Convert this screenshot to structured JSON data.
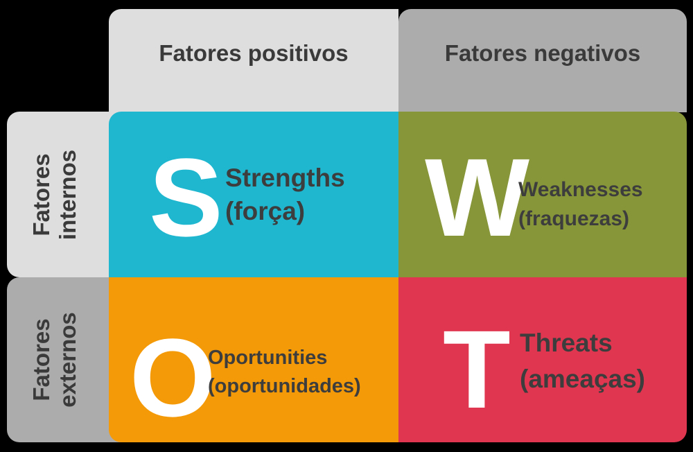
{
  "columns": {
    "positive": "Fatores positivos",
    "negative": "Fatores negativos"
  },
  "rows": {
    "internal": {
      "line1": "Fatores",
      "line2": "internos"
    },
    "external": {
      "line1": "Fatores",
      "line2": "externos"
    }
  },
  "quadrants": {
    "s": {
      "letter": "S",
      "title": "Strengths",
      "subtitle": "(força)",
      "color": "#1fb7d0"
    },
    "w": {
      "letter": "W",
      "title": "Weaknesses",
      "subtitle": "(fraquezas)",
      "color": "#879639"
    },
    "o": {
      "letter": "O",
      "title": "Oportunities",
      "subtitle": "(oportunidades)",
      "color": "#f49a08"
    },
    "t": {
      "letter": "T",
      "title": "Threats",
      "subtitle": "(ameaças)",
      "color": "#e0364f"
    }
  }
}
